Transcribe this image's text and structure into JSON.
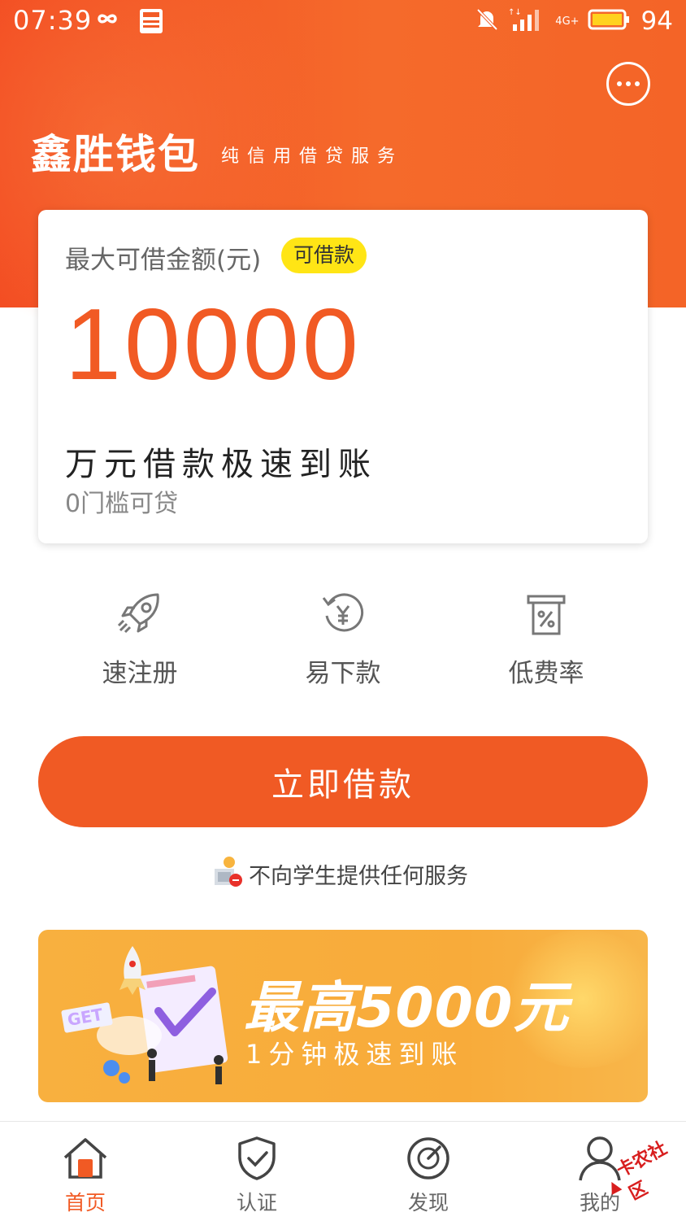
{
  "status_bar": {
    "time": "07:39",
    "battery": "94",
    "network": "4G+"
  },
  "header": {
    "brand": "鑫胜钱包",
    "tagline": "纯信用借贷服务"
  },
  "loan_card": {
    "label": "最大可借金额(元)",
    "badge": "可借款",
    "amount": "10000",
    "headline": "万元借款极速到账",
    "subline": "0门槛可贷"
  },
  "features": [
    {
      "label": "速注册",
      "icon": "rocket-icon"
    },
    {
      "label": "易下款",
      "icon": "yuan-refresh-icon"
    },
    {
      "label": "低费率",
      "icon": "percent-receipt-icon"
    }
  ],
  "cta": {
    "label": "立即借款"
  },
  "notice": {
    "text": "不向学生提供任何服务",
    "icon": "student-icon"
  },
  "banner": {
    "title": "最高5000元",
    "subtitle": "1分钟极速到账",
    "art_text": "GET"
  },
  "tabs": [
    {
      "label": "首页",
      "icon": "home-icon",
      "active": true
    },
    {
      "label": "认证",
      "icon": "shield-check-icon",
      "active": false
    },
    {
      "label": "发现",
      "icon": "compass-icon",
      "active": false
    },
    {
      "label": "我的",
      "icon": "user-icon",
      "active": false
    }
  ],
  "watermark": {
    "text": "卡农社区"
  },
  "colors": {
    "brand": "#f15a24",
    "badge": "#ffe515",
    "banner": "#f8ab3a"
  }
}
